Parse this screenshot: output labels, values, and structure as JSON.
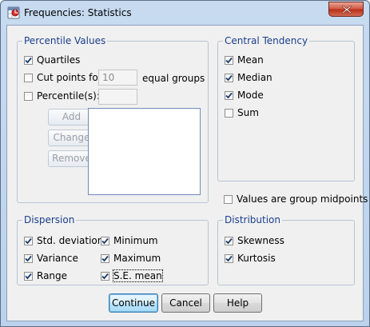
{
  "window": {
    "title": "Frequencies: Statistics",
    "icon": "spss-table-icon",
    "close_icon": "close-icon"
  },
  "percentile_values": {
    "label": "Percentile Values",
    "quartiles": {
      "label": "Quartiles",
      "checked": true
    },
    "cut_points": {
      "label": "Cut points for:",
      "checked": false,
      "value": "10",
      "suffix": "equal groups"
    },
    "percentiles": {
      "label": "Percentile(s):",
      "checked": false,
      "value": ""
    },
    "buttons": {
      "add": "Add",
      "change": "Change",
      "remove": "Remove"
    }
  },
  "central_tendency": {
    "label": "Central Tendency",
    "items": [
      {
        "label": "Mean",
        "checked": true
      },
      {
        "label": "Median",
        "checked": true
      },
      {
        "label": "Mode",
        "checked": true
      },
      {
        "label": "Sum",
        "checked": false
      }
    ]
  },
  "group_midpoints": {
    "label": "Values are group midpoints",
    "checked": false
  },
  "dispersion": {
    "label": "Dispersion",
    "items": [
      {
        "label": "Std. deviation",
        "checked": true
      },
      {
        "label": "Minimum",
        "checked": true
      },
      {
        "label": "Variance",
        "checked": true
      },
      {
        "label": "Maximum",
        "checked": true
      },
      {
        "label": "Range",
        "checked": true
      },
      {
        "label": "S.E. mean",
        "checked": true
      }
    ]
  },
  "distribution": {
    "label": "Distribution",
    "items": [
      {
        "label": "Skewness",
        "checked": true
      },
      {
        "label": "Kurtosis",
        "checked": true
      }
    ]
  },
  "footer": {
    "continue": "Continue",
    "cancel": "Cancel",
    "help": "Help"
  }
}
